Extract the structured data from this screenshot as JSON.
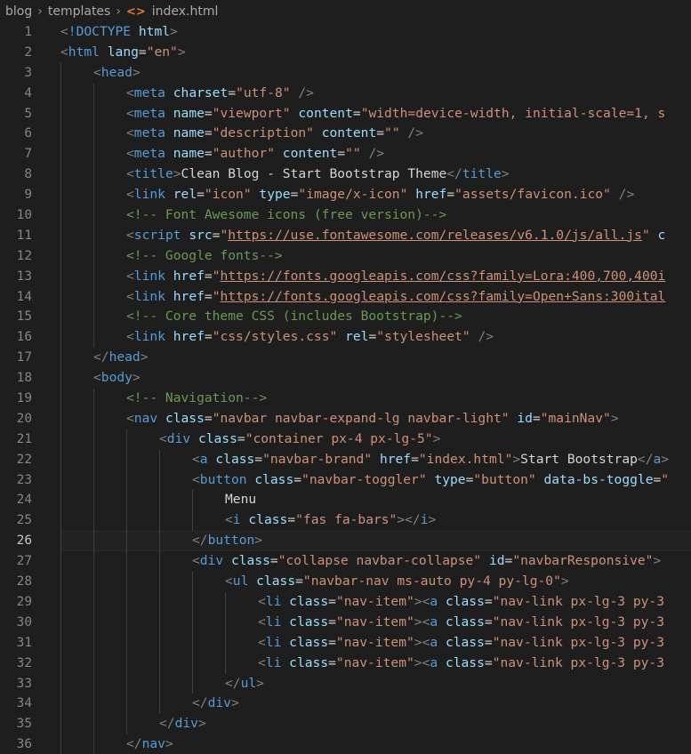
{
  "breadcrumb": {
    "segments": [
      "blog",
      "templates"
    ],
    "file": "index.html",
    "file_icon": "html-file-icon"
  },
  "colors": {
    "background": "#1e1e1e",
    "tag": "#569cd6",
    "attribute": "#9cdcfe",
    "string": "#ce9178",
    "punctuation": "#808080",
    "text": "#d4d4d4",
    "comment": "#6a9955",
    "line_number": "#858585"
  },
  "editor": {
    "current_line": 26,
    "lines": [
      {
        "n": "1",
        "indent": 0,
        "tokens": [
          [
            "p",
            "<"
          ],
          [
            "t",
            "!DOCTYPE"
          ],
          [
            "x",
            " "
          ],
          [
            "a",
            "html"
          ],
          [
            "p",
            ">"
          ]
        ]
      },
      {
        "n": "2",
        "indent": 0,
        "tokens": [
          [
            "p",
            "<"
          ],
          [
            "t",
            "html"
          ],
          [
            "x",
            " "
          ],
          [
            "a",
            "lang"
          ],
          [
            "x",
            "="
          ],
          [
            "s",
            "\"en\""
          ],
          [
            "p",
            ">"
          ]
        ]
      },
      {
        "n": "3",
        "indent": 1,
        "tokens": [
          [
            "p",
            "<"
          ],
          [
            "t",
            "head"
          ],
          [
            "p",
            ">"
          ]
        ]
      },
      {
        "n": "4",
        "indent": 2,
        "tokens": [
          [
            "p",
            "<"
          ],
          [
            "t",
            "meta"
          ],
          [
            "x",
            " "
          ],
          [
            "a",
            "charset"
          ],
          [
            "x",
            "="
          ],
          [
            "s",
            "\"utf-8\""
          ],
          [
            "x",
            " "
          ],
          [
            "p",
            "/>"
          ]
        ]
      },
      {
        "n": "5",
        "indent": 2,
        "tokens": [
          [
            "p",
            "<"
          ],
          [
            "t",
            "meta"
          ],
          [
            "x",
            " "
          ],
          [
            "a",
            "name"
          ],
          [
            "x",
            "="
          ],
          [
            "s",
            "\"viewport\""
          ],
          [
            "x",
            " "
          ],
          [
            "a",
            "content"
          ],
          [
            "x",
            "="
          ],
          [
            "s",
            "\"width=device-width, initial-scale=1, s"
          ]
        ]
      },
      {
        "n": "6",
        "indent": 2,
        "tokens": [
          [
            "p",
            "<"
          ],
          [
            "t",
            "meta"
          ],
          [
            "x",
            " "
          ],
          [
            "a",
            "name"
          ],
          [
            "x",
            "="
          ],
          [
            "s",
            "\"description\""
          ],
          [
            "x",
            " "
          ],
          [
            "a",
            "content"
          ],
          [
            "x",
            "="
          ],
          [
            "s",
            "\"\""
          ],
          [
            "x",
            " "
          ],
          [
            "p",
            "/>"
          ]
        ]
      },
      {
        "n": "7",
        "indent": 2,
        "tokens": [
          [
            "p",
            "<"
          ],
          [
            "t",
            "meta"
          ],
          [
            "x",
            " "
          ],
          [
            "a",
            "name"
          ],
          [
            "x",
            "="
          ],
          [
            "s",
            "\"author\""
          ],
          [
            "x",
            " "
          ],
          [
            "a",
            "content"
          ],
          [
            "x",
            "="
          ],
          [
            "s",
            "\"\""
          ],
          [
            "x",
            " "
          ],
          [
            "p",
            "/>"
          ]
        ]
      },
      {
        "n": "8",
        "indent": 2,
        "tokens": [
          [
            "p",
            "<"
          ],
          [
            "t",
            "title"
          ],
          [
            "p",
            ">"
          ],
          [
            "x",
            "Clean Blog - Start Bootstrap Theme"
          ],
          [
            "p",
            "</"
          ],
          [
            "t",
            "title"
          ],
          [
            "p",
            ">"
          ]
        ]
      },
      {
        "n": "9",
        "indent": 2,
        "tokens": [
          [
            "p",
            "<"
          ],
          [
            "t",
            "link"
          ],
          [
            "x",
            " "
          ],
          [
            "a",
            "rel"
          ],
          [
            "x",
            "="
          ],
          [
            "s",
            "\"icon\""
          ],
          [
            "x",
            " "
          ],
          [
            "a",
            "type"
          ],
          [
            "x",
            "="
          ],
          [
            "s",
            "\"image/x-icon\""
          ],
          [
            "x",
            " "
          ],
          [
            "a",
            "href"
          ],
          [
            "x",
            "="
          ],
          [
            "s",
            "\"assets/favicon.ico\""
          ],
          [
            "x",
            " "
          ],
          [
            "p",
            "/>"
          ]
        ]
      },
      {
        "n": "10",
        "indent": 2,
        "tokens": [
          [
            "c",
            "<!-- Font Awesome icons (free version)-->"
          ]
        ]
      },
      {
        "n": "11",
        "indent": 2,
        "tokens": [
          [
            "p",
            "<"
          ],
          [
            "t",
            "script"
          ],
          [
            "x",
            " "
          ],
          [
            "a",
            "src"
          ],
          [
            "x",
            "="
          ],
          [
            "s",
            "\""
          ],
          [
            "u",
            "https://use.fontawesome.com/releases/v6.1.0/js/all.js"
          ],
          [
            "s",
            "\""
          ],
          [
            "x",
            " "
          ],
          [
            "a",
            "c"
          ]
        ]
      },
      {
        "n": "12",
        "indent": 2,
        "tokens": [
          [
            "c",
            "<!-- Google fonts-->"
          ]
        ]
      },
      {
        "n": "13",
        "indent": 2,
        "tokens": [
          [
            "p",
            "<"
          ],
          [
            "t",
            "link"
          ],
          [
            "x",
            " "
          ],
          [
            "a",
            "href"
          ],
          [
            "x",
            "="
          ],
          [
            "s",
            "\""
          ],
          [
            "u",
            "https://fonts.googleapis.com/css?family=Lora:400,700,400i"
          ]
        ]
      },
      {
        "n": "14",
        "indent": 2,
        "tokens": [
          [
            "p",
            "<"
          ],
          [
            "t",
            "link"
          ],
          [
            "x",
            " "
          ],
          [
            "a",
            "href"
          ],
          [
            "x",
            "="
          ],
          [
            "s",
            "\""
          ],
          [
            "u",
            "https://fonts.googleapis.com/css?family=Open+Sans:300ital"
          ]
        ]
      },
      {
        "n": "15",
        "indent": 2,
        "tokens": [
          [
            "c",
            "<!-- Core theme CSS (includes Bootstrap)-->"
          ]
        ]
      },
      {
        "n": "16",
        "indent": 2,
        "tokens": [
          [
            "p",
            "<"
          ],
          [
            "t",
            "link"
          ],
          [
            "x",
            " "
          ],
          [
            "a",
            "href"
          ],
          [
            "x",
            "="
          ],
          [
            "s",
            "\"css/styles.css\""
          ],
          [
            "x",
            " "
          ],
          [
            "a",
            "rel"
          ],
          [
            "x",
            "="
          ],
          [
            "s",
            "\"stylesheet\""
          ],
          [
            "x",
            " "
          ],
          [
            "p",
            "/>"
          ]
        ]
      },
      {
        "n": "17",
        "indent": 1,
        "tokens": [
          [
            "p",
            "</"
          ],
          [
            "t",
            "head"
          ],
          [
            "p",
            ">"
          ]
        ]
      },
      {
        "n": "18",
        "indent": 1,
        "tokens": [
          [
            "p",
            "<"
          ],
          [
            "t",
            "body"
          ],
          [
            "p",
            ">"
          ]
        ]
      },
      {
        "n": "19",
        "indent": 2,
        "tokens": [
          [
            "c",
            "<!-- Navigation-->"
          ]
        ]
      },
      {
        "n": "20",
        "indent": 2,
        "tokens": [
          [
            "p",
            "<"
          ],
          [
            "t",
            "nav"
          ],
          [
            "x",
            " "
          ],
          [
            "a",
            "class"
          ],
          [
            "x",
            "="
          ],
          [
            "s",
            "\"navbar navbar-expand-lg navbar-light\""
          ],
          [
            "x",
            " "
          ],
          [
            "a",
            "id"
          ],
          [
            "x",
            "="
          ],
          [
            "s",
            "\"mainNav\""
          ],
          [
            "p",
            ">"
          ]
        ]
      },
      {
        "n": "21",
        "indent": 3,
        "tokens": [
          [
            "p",
            "<"
          ],
          [
            "t",
            "div"
          ],
          [
            "x",
            " "
          ],
          [
            "a",
            "class"
          ],
          [
            "x",
            "="
          ],
          [
            "s",
            "\"container px-4 px-lg-5\""
          ],
          [
            "p",
            ">"
          ]
        ]
      },
      {
        "n": "22",
        "indent": 4,
        "tokens": [
          [
            "p",
            "<"
          ],
          [
            "t",
            "a"
          ],
          [
            "x",
            " "
          ],
          [
            "a",
            "class"
          ],
          [
            "x",
            "="
          ],
          [
            "s",
            "\"navbar-brand\""
          ],
          [
            "x",
            " "
          ],
          [
            "a",
            "href"
          ],
          [
            "x",
            "="
          ],
          [
            "s",
            "\"index.html\""
          ],
          [
            "p",
            ">"
          ],
          [
            "x",
            "Start Bootstrap"
          ],
          [
            "p",
            "</"
          ],
          [
            "t",
            "a"
          ],
          [
            "p",
            ">"
          ]
        ]
      },
      {
        "n": "23",
        "indent": 4,
        "tokens": [
          [
            "p",
            "<"
          ],
          [
            "t",
            "button"
          ],
          [
            "x",
            " "
          ],
          [
            "a",
            "class"
          ],
          [
            "x",
            "="
          ],
          [
            "s",
            "\"navbar-toggler\""
          ],
          [
            "x",
            " "
          ],
          [
            "a",
            "type"
          ],
          [
            "x",
            "="
          ],
          [
            "s",
            "\"button\""
          ],
          [
            "x",
            " "
          ],
          [
            "a",
            "data-bs-toggle"
          ],
          [
            "x",
            "="
          ],
          [
            "s",
            "\""
          ]
        ]
      },
      {
        "n": "24",
        "indent": 5,
        "tokens": [
          [
            "x",
            "Menu"
          ]
        ]
      },
      {
        "n": "25",
        "indent": 5,
        "tokens": [
          [
            "p",
            "<"
          ],
          [
            "t",
            "i"
          ],
          [
            "x",
            " "
          ],
          [
            "a",
            "class"
          ],
          [
            "x",
            "="
          ],
          [
            "s",
            "\"fas fa-bars\""
          ],
          [
            "p",
            "></"
          ],
          [
            "t",
            "i"
          ],
          [
            "p",
            ">"
          ]
        ]
      },
      {
        "n": "26",
        "indent": 4,
        "tokens": [
          [
            "p",
            "</"
          ],
          [
            "t",
            "button"
          ],
          [
            "p",
            ">"
          ]
        ]
      },
      {
        "n": "27",
        "indent": 4,
        "tokens": [
          [
            "p",
            "<"
          ],
          [
            "t",
            "div"
          ],
          [
            "x",
            " "
          ],
          [
            "a",
            "class"
          ],
          [
            "x",
            "="
          ],
          [
            "s",
            "\"collapse navbar-collapse\""
          ],
          [
            "x",
            " "
          ],
          [
            "a",
            "id"
          ],
          [
            "x",
            "="
          ],
          [
            "s",
            "\"navbarResponsive\""
          ],
          [
            "p",
            ">"
          ]
        ]
      },
      {
        "n": "28",
        "indent": 5,
        "tokens": [
          [
            "p",
            "<"
          ],
          [
            "t",
            "ul"
          ],
          [
            "x",
            " "
          ],
          [
            "a",
            "class"
          ],
          [
            "x",
            "="
          ],
          [
            "s",
            "\"navbar-nav ms-auto py-4 py-lg-0\""
          ],
          [
            "p",
            ">"
          ]
        ]
      },
      {
        "n": "29",
        "indent": 6,
        "tokens": [
          [
            "p",
            "<"
          ],
          [
            "t",
            "li"
          ],
          [
            "x",
            " "
          ],
          [
            "a",
            "class"
          ],
          [
            "x",
            "="
          ],
          [
            "s",
            "\"nav-item\""
          ],
          [
            "p",
            "><"
          ],
          [
            "t",
            "a"
          ],
          [
            "x",
            " "
          ],
          [
            "a",
            "class"
          ],
          [
            "x",
            "="
          ],
          [
            "s",
            "\"nav-link px-lg-3 py-3"
          ]
        ]
      },
      {
        "n": "30",
        "indent": 6,
        "tokens": [
          [
            "p",
            "<"
          ],
          [
            "t",
            "li"
          ],
          [
            "x",
            " "
          ],
          [
            "a",
            "class"
          ],
          [
            "x",
            "="
          ],
          [
            "s",
            "\"nav-item\""
          ],
          [
            "p",
            "><"
          ],
          [
            "t",
            "a"
          ],
          [
            "x",
            " "
          ],
          [
            "a",
            "class"
          ],
          [
            "x",
            "="
          ],
          [
            "s",
            "\"nav-link px-lg-3 py-3"
          ]
        ]
      },
      {
        "n": "31",
        "indent": 6,
        "tokens": [
          [
            "p",
            "<"
          ],
          [
            "t",
            "li"
          ],
          [
            "x",
            " "
          ],
          [
            "a",
            "class"
          ],
          [
            "x",
            "="
          ],
          [
            "s",
            "\"nav-item\""
          ],
          [
            "p",
            "><"
          ],
          [
            "t",
            "a"
          ],
          [
            "x",
            " "
          ],
          [
            "a",
            "class"
          ],
          [
            "x",
            "="
          ],
          [
            "s",
            "\"nav-link px-lg-3 py-3"
          ]
        ]
      },
      {
        "n": "32",
        "indent": 6,
        "tokens": [
          [
            "p",
            "<"
          ],
          [
            "t",
            "li"
          ],
          [
            "x",
            " "
          ],
          [
            "a",
            "class"
          ],
          [
            "x",
            "="
          ],
          [
            "s",
            "\"nav-item\""
          ],
          [
            "p",
            "><"
          ],
          [
            "t",
            "a"
          ],
          [
            "x",
            " "
          ],
          [
            "a",
            "class"
          ],
          [
            "x",
            "="
          ],
          [
            "s",
            "\"nav-link px-lg-3 py-3"
          ]
        ]
      },
      {
        "n": "33",
        "indent": 5,
        "tokens": [
          [
            "p",
            "</"
          ],
          [
            "t",
            "ul"
          ],
          [
            "p",
            ">"
          ]
        ]
      },
      {
        "n": "34",
        "indent": 4,
        "tokens": [
          [
            "p",
            "</"
          ],
          [
            "t",
            "div"
          ],
          [
            "p",
            ">"
          ]
        ]
      },
      {
        "n": "35",
        "indent": 3,
        "tokens": [
          [
            "p",
            "</"
          ],
          [
            "t",
            "div"
          ],
          [
            "p",
            ">"
          ]
        ]
      },
      {
        "n": "36",
        "indent": 2,
        "tokens": [
          [
            "p",
            "</"
          ],
          [
            "t",
            "nav"
          ],
          [
            "p",
            ">"
          ]
        ]
      }
    ]
  }
}
